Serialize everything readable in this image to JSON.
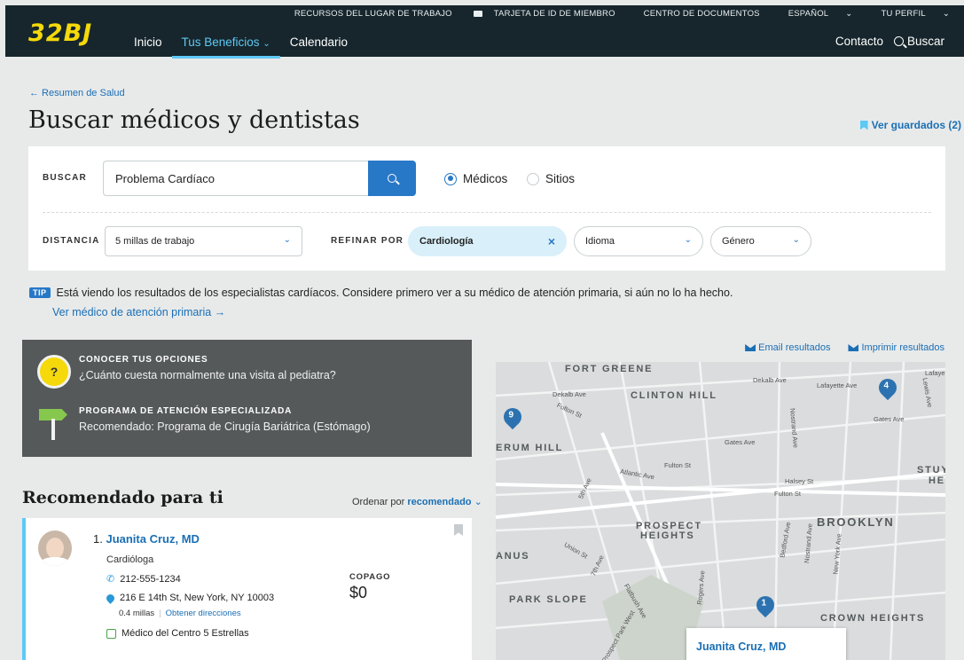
{
  "header": {
    "logo": "32BJ",
    "utility": [
      "RECURSOS DEL LUGAR DE TRABAJO",
      "TARJETA DE ID DE MIEMBRO",
      "CENTRO DE DOCUMENTOS",
      "ESPAÑOL",
      "TU PERFIL"
    ],
    "nav": [
      "Inicio",
      "Tus Beneficios",
      "Calendario"
    ],
    "contact": "Contacto",
    "search": "Buscar"
  },
  "page": {
    "back_link": "← Resumen de Salud",
    "title": "Buscar médicos y dentistas",
    "saved": "Ver guardados (2)"
  },
  "search": {
    "label": "BUSCAR",
    "value": "Problema Cardíaco",
    "radio_doctors": "Médicos",
    "radio_sites": "Sitios",
    "distance_label": "DISTANCIA",
    "distance_value": "5 millas de trabajo",
    "refine_label": "REFINAR POR",
    "refine_active": "Cardiología",
    "language": "Idioma",
    "gender": "Género"
  },
  "tip": {
    "tag": "TIP",
    "text": "Está viendo los resultados de los especialistas cardíacos. Considere primero ver a su médico de atención primaria, si aún no lo ha hecho.",
    "link": "Ver médico de atención primaria →"
  },
  "info": {
    "q_icon": "?",
    "h1": "CONOCER TUS OPCIONES",
    "s1": "¿Cuánto cuesta normalmente una visita al pediatra?",
    "h2": "PROGRAMA DE ATENCIÓN ESPECIALIZADA",
    "s2": "Recomendado: Programa de Cirugía Bariátrica (Estómago)"
  },
  "results": {
    "title": "Recomendado para ti",
    "sort_label": "Ordenar por",
    "sort_value": "recomendado",
    "item": {
      "num": "1.",
      "name": "Juanita Cruz, MD",
      "specialty": "Cardióloga",
      "phone": "212-555-1234",
      "address": "216 E 14th St, New York, NY 10003",
      "distance": "0.4 millas",
      "directions": "Obtener direcciones",
      "badge": "Médico del Centro 5 Estrellas",
      "copay_label": "COPAGO",
      "copay_value": "$0"
    }
  },
  "map": {
    "email": "Email resultados",
    "print": "Imprimir resultados",
    "areas": [
      "FORT GREENE",
      "CLINTON HILL",
      "ERUM HILL",
      "PROSPECT",
      "HEIGHTS",
      "BROOKLYN",
      "ANUS",
      "PARK SLOPE",
      "CROWN HEIGHTS",
      "STUY",
      "HE"
    ],
    "streets": [
      "Dekalb Ave",
      "Dekalb Ave",
      "Lafayette Ave",
      "Lafaye",
      "Fulton St",
      "Gates Ave",
      "Fulton St",
      "Atlantic Ave",
      "Halsey St",
      "Fulton St",
      "Union St",
      "5th Ave",
      "7th Ave",
      "Flatbush Ave",
      "Prospect Park West",
      "Bedford Ave",
      "Nostrand Ave",
      "New York Ave",
      "Rogers Ave",
      "Nostrand Ave",
      "Lewis Ave",
      "Gates Ave"
    ],
    "pins": [
      "9",
      "4",
      "1"
    ],
    "popup": "Juanita Cruz, MD"
  },
  "colors": {
    "header_bg": "#16262c",
    "logo": "#f5d90a",
    "accent": "#2878c8",
    "link": "#1a6fb5",
    "nav_active": "#5ec9f5"
  }
}
